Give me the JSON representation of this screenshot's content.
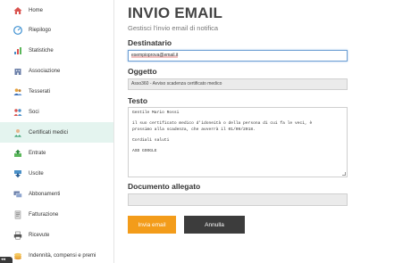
{
  "sidebar": {
    "items": [
      {
        "label": "Home",
        "icon": "home-icon"
      },
      {
        "label": "Riepilogo",
        "icon": "speedometer-icon"
      },
      {
        "label": "Statistiche",
        "icon": "chart-icon"
      },
      {
        "label": "Associazione",
        "icon": "building-icon"
      },
      {
        "label": "Tesserati",
        "icon": "users-icon"
      },
      {
        "label": "Soci",
        "icon": "people-icon"
      },
      {
        "label": "Certificati medici",
        "icon": "doctor-icon"
      },
      {
        "label": "Entrate",
        "icon": "income-icon"
      },
      {
        "label": "Uscite",
        "icon": "expense-icon"
      },
      {
        "label": "Abbonamenti",
        "icon": "cards-icon"
      },
      {
        "label": "Fatturazione",
        "icon": "invoice-icon"
      },
      {
        "label": "Ricevute",
        "icon": "printer-icon"
      },
      {
        "label": "Indennità, compensi e premi",
        "icon": "coins-icon"
      }
    ],
    "active_index": 6,
    "toggle_label": "◂◂"
  },
  "header": {
    "title": "INVIO EMAIL",
    "subtitle": "Gestisci l'invio email di notifica"
  },
  "form": {
    "recipient": {
      "label": "Destinatario",
      "value": "esempioprova@email.it"
    },
    "subject": {
      "label": "Oggetto",
      "value": "Asso360 - Avviso scadenza certificato medico"
    },
    "body": {
      "label": "Testo",
      "value": "Gentile Mario Rossi\n\nil suo certificato medico d'idoneità o della persona di cui fa le veci, è\nprossimo alla scadenza, che avverrà il 01/09/2018.\n\nCordiali saluti\n\nASD GOOGLE"
    },
    "attachment": {
      "label": "Documento allegato",
      "value": ""
    }
  },
  "actions": {
    "send_label": "Invia email",
    "cancel_label": "Annulla"
  },
  "colors": {
    "accent": "#f39c1a",
    "dark_button": "#3c3c3c",
    "active_nav": "#e4f4ef"
  }
}
